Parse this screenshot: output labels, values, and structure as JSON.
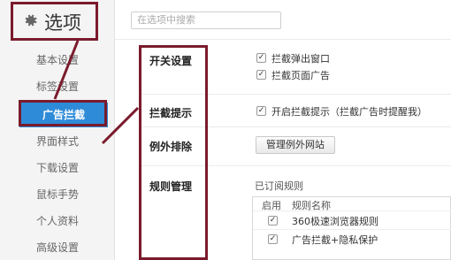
{
  "header": {
    "title": "选项",
    "search_placeholder": "在选项中搜索"
  },
  "sidebar": {
    "items": [
      {
        "label": "基本设置"
      },
      {
        "label": "标签设置"
      },
      {
        "label": "广告拦截"
      },
      {
        "label": "界面样式"
      },
      {
        "label": "下载设置"
      },
      {
        "label": "鼠标手势"
      },
      {
        "label": "个人资料"
      },
      {
        "label": "高级设置"
      }
    ],
    "active_index": 2
  },
  "sections": {
    "switch": {
      "label": "开关设置",
      "options": [
        {
          "label": "拦截弹出窗口",
          "checked": true
        },
        {
          "label": "拦截页面广告",
          "checked": true
        }
      ]
    },
    "notify": {
      "label": "拦截提示",
      "option": {
        "label": "开启拦截提示（拦截广告时提醒我）",
        "checked": true
      }
    },
    "exceptions": {
      "label": "例外排除",
      "button_label": "管理例外网站"
    },
    "rules": {
      "label": "规则管理",
      "subscribed_label": "已订阅规则",
      "columns": [
        "启用",
        "规则名称"
      ],
      "rows": [
        {
          "enabled": true,
          "name": "360极速浏览器规则"
        },
        {
          "enabled": true,
          "name": "广告拦截+隐私保护"
        }
      ]
    }
  },
  "colors": {
    "accent": "#2e8bd8",
    "annotation": "#7a1b2c"
  }
}
